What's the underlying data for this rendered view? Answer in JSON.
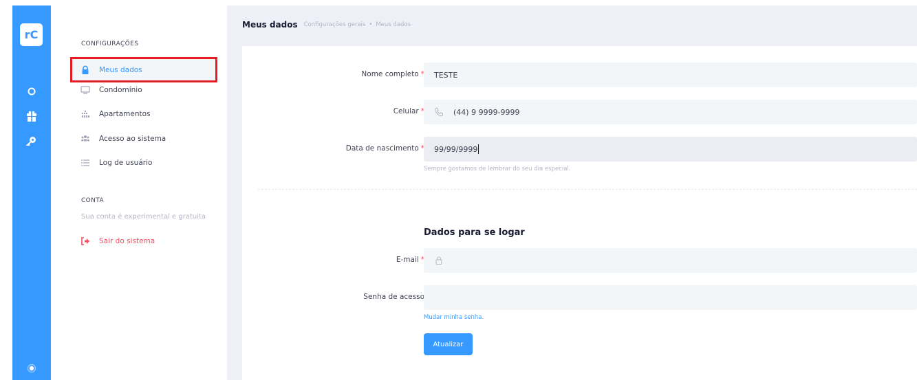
{
  "app": {
    "logo_text": "rC",
    "rail_icons": [
      "circle-icon",
      "gift-icon",
      "key-icon",
      "settings-icon"
    ]
  },
  "sidebar": {
    "section_config": "CONFIGURAÇÕES",
    "items": [
      {
        "label": "Meus dados",
        "icon": "lock-icon",
        "active": true
      },
      {
        "label": "Condomínio",
        "icon": "monitor-icon"
      },
      {
        "label": "Apartamentos",
        "icon": "building-icon"
      },
      {
        "label": "Acesso ao sistema",
        "icon": "users-icon"
      },
      {
        "label": "Log de usuário",
        "icon": "list-icon"
      }
    ],
    "section_account": "CONTA",
    "account_note": "Sua conta é experimental e gratuita",
    "logout_label": "Sair do sistema"
  },
  "header": {
    "title": "Meus dados",
    "breadcrumb": [
      "Configurações gerais",
      "Meus dados"
    ],
    "breadcrumb_separator": "•"
  },
  "form": {
    "required_mark": "*",
    "name": {
      "label": "Nome completo",
      "value": "TESTE"
    },
    "phone": {
      "label": "Celular",
      "value": "(44) 9 9999-9999"
    },
    "birth": {
      "label": "Data de nascimento",
      "value": "99/99/9999",
      "hint": "Sempre gostamos de lembrar do seu dia especial."
    },
    "login_heading": "Dados para se logar",
    "email": {
      "label": "E-mail",
      "value": ""
    },
    "password": {
      "label": "Senha de acesso",
      "value": "",
      "link": "Mudar minha senha."
    },
    "submit_label": "Atualizar"
  },
  "colors": {
    "primary": "#3699ff",
    "danger": "#f64e60",
    "highlight_border": "#e51b23",
    "background": "#eef0f8"
  }
}
